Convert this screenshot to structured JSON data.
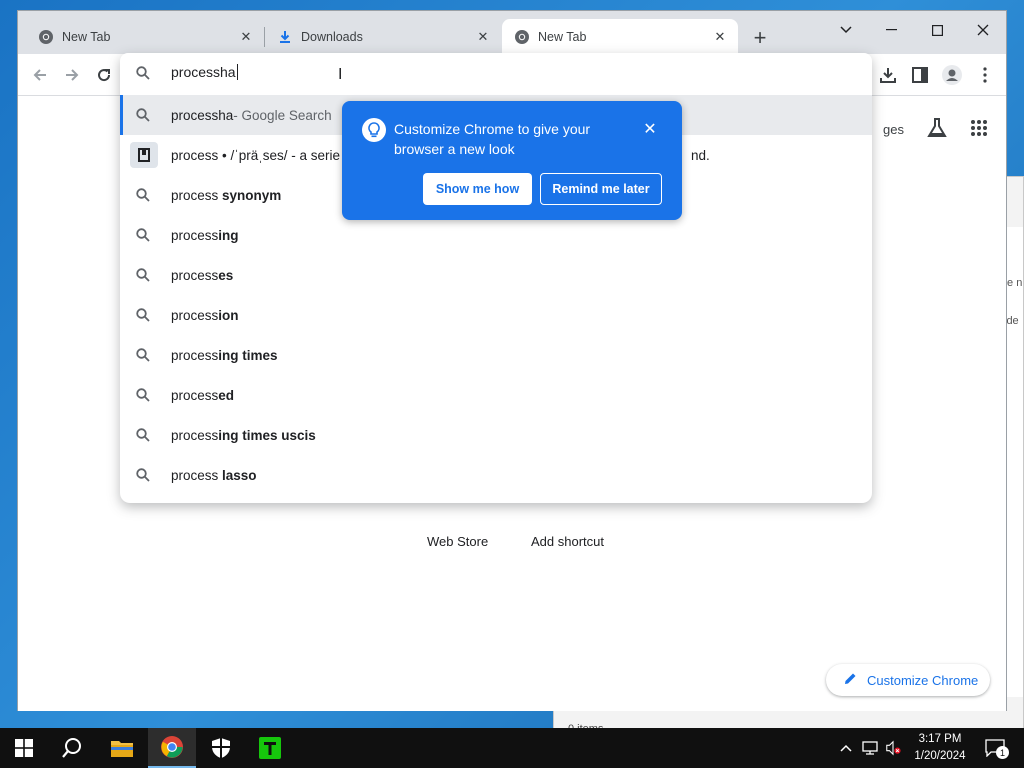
{
  "tabs": [
    {
      "title": "New Tab",
      "icon": "chrome-icon"
    },
    {
      "title": "Downloads",
      "icon": "download-icon"
    },
    {
      "title": "New Tab",
      "icon": "chrome-icon"
    }
  ],
  "omnibox": {
    "value": "processha"
  },
  "suggestions": [
    {
      "plain": "processha",
      "bold": "",
      "suffix": " - Google Search",
      "icon": "search-icon"
    },
    {
      "plain": "process • /ˈpräˌses/ - a serie",
      "bold": "",
      "suffix": "nd.",
      "icon": "dictionary-icon"
    },
    {
      "plain": "process ",
      "bold": "synonym",
      "icon": "search-icon"
    },
    {
      "plain": "process",
      "bold": "ing",
      "icon": "search-icon"
    },
    {
      "plain": "process",
      "bold": "es",
      "icon": "search-icon"
    },
    {
      "plain": "process",
      "bold": "ion",
      "icon": "search-icon"
    },
    {
      "plain": "process",
      "bold": "ing times",
      "icon": "search-icon"
    },
    {
      "plain": "process",
      "bold": "ed",
      "icon": "search-icon"
    },
    {
      "plain": "process",
      "bold": "ing times uscis",
      "icon": "search-icon"
    },
    {
      "plain": "process ",
      "bold": "lasso",
      "icon": "search-icon"
    }
  ],
  "promo": {
    "text": "Customize Chrome to give your browser a new look",
    "primary": "Show me how",
    "secondary": "Remind me later"
  },
  "ntp": {
    "links_partial": "ges",
    "shortcuts": [
      "Web Store",
      "Add shortcut"
    ],
    "customize": "Customize Chrome"
  },
  "background_window": {
    "status": "0 items",
    "text_1": "te n",
    "text_2": "lde"
  },
  "taskbar": {
    "time": "3:17 PM",
    "date": "1/20/2024",
    "notification_count": "1"
  },
  "colors": {
    "accent": "#1a73e8",
    "taskbar": "#101010",
    "desktop": "#1e7fcf"
  }
}
